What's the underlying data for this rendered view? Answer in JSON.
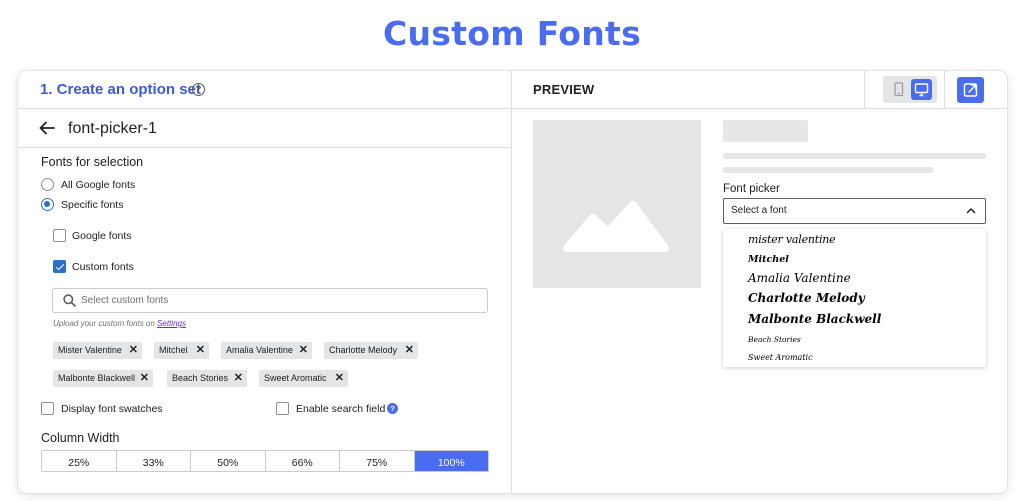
{
  "page_title": "Custom Fonts",
  "left": {
    "step_title": "1. Create an option set",
    "help_glyph": "?",
    "option_set_name": "font-picker-1",
    "fonts_for_selection_label": "Fonts for selection",
    "radio_all": "All Google fonts",
    "radio_specific": "Specific fonts",
    "cb_google": "Google fonts",
    "cb_custom": "Custom fonts",
    "search_placeholder": "Select custom fonts",
    "upload_note_prefix": "Upload your custom fonts on ",
    "upload_note_link": "Settings",
    "tags": [
      "Mister Valentine",
      "Mitchel",
      "Amalia Valentine",
      "Charlotte Melody",
      "Malbonte Blackwell",
      "Beach Stories",
      "Sweet Aromatic"
    ],
    "tag_remove_glyph": "✕",
    "display_swatches_label": "Display font swatches",
    "enable_search_label": "Enable search field",
    "info_glyph": "?",
    "column_width_label": "Column Width",
    "column_widths": [
      "25%",
      "33%",
      "50%",
      "66%",
      "75%",
      "100%"
    ],
    "selected_width": "100%"
  },
  "right": {
    "preview_label": "PREVIEW",
    "font_picker_label": "Font picker",
    "select_placeholder": "Select a font",
    "font_options": [
      "mister valentine",
      "Mitchel",
      "Amalia Valentine",
      "Charlotte Melody",
      "Malbonte Blackwell",
      "Beach Stories",
      "Sweet Aromatic"
    ]
  },
  "colors": {
    "accent": "#4a6cf0",
    "checkbox": "#2c6ecb",
    "link": "#6b2ac9"
  }
}
